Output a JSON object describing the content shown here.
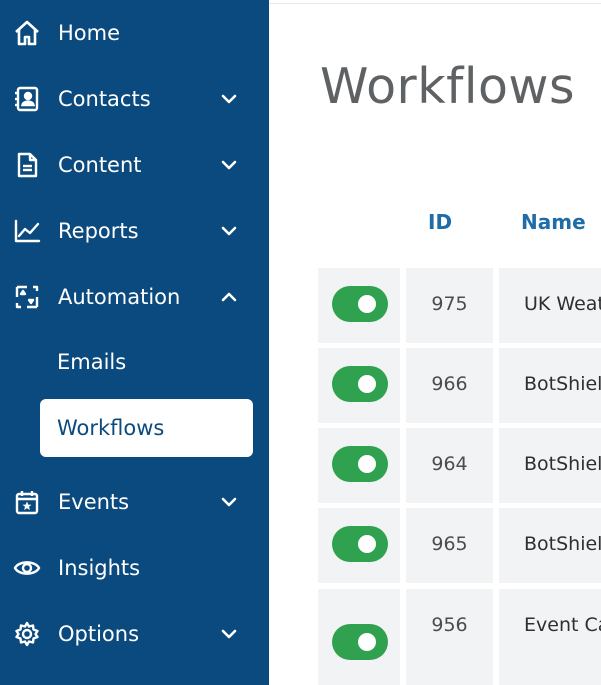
{
  "sidebar": {
    "items": [
      {
        "label": "Home",
        "icon": "home-icon",
        "chevron": "none"
      },
      {
        "label": "Contacts",
        "icon": "contacts-book-icon",
        "chevron": "down"
      },
      {
        "label": "Content",
        "icon": "document-icon",
        "chevron": "down"
      },
      {
        "label": "Reports",
        "icon": "line-chart-icon",
        "chevron": "down"
      },
      {
        "label": "Automation",
        "icon": "automation-arrows-icon",
        "chevron": "up"
      },
      {
        "label": "Events",
        "icon": "calendar-star-icon",
        "chevron": "down"
      },
      {
        "label": "Insights",
        "icon": "eye-icon",
        "chevron": "none"
      },
      {
        "label": "Options",
        "icon": "gear-icon",
        "chevron": "down"
      }
    ],
    "subitems": [
      {
        "label": "Emails",
        "active": false
      },
      {
        "label": "Workflows",
        "active": true
      }
    ]
  },
  "main": {
    "title": "Workflows",
    "columns": {
      "id": "ID",
      "name": "Name"
    },
    "rows": [
      {
        "enabled": true,
        "id": "975",
        "name": "UK Weather"
      },
      {
        "enabled": true,
        "id": "966",
        "name": "BotShield"
      },
      {
        "enabled": true,
        "id": "964",
        "name": "BotShield"
      },
      {
        "enabled": true,
        "id": "965",
        "name": "BotShield"
      },
      {
        "enabled": true,
        "id": "956",
        "name": "Event Calendar"
      }
    ]
  },
  "colors": {
    "sidebar_bg": "#0b4a7e",
    "accent": "#1f6da8",
    "toggle_on": "#30a14e",
    "row_bg": "#f2f3f4"
  }
}
